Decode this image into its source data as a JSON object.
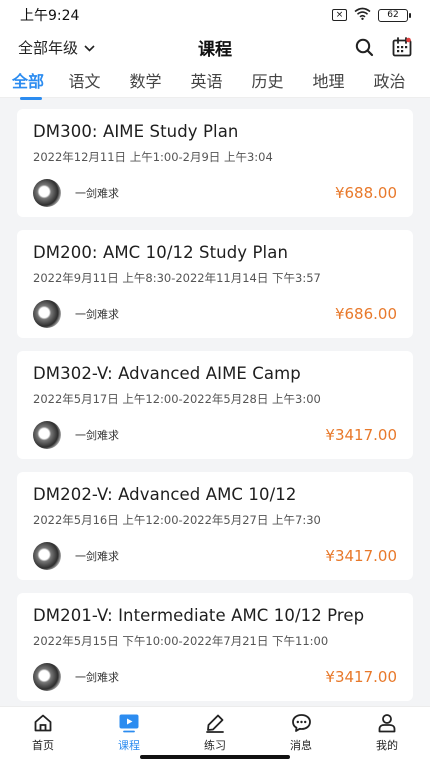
{
  "status_bar": {
    "time": "上午9:24",
    "x_label": "×",
    "battery": "62"
  },
  "header": {
    "grade_select": "全部年级",
    "title": "课程"
  },
  "tabs": [
    {
      "label": "全部"
    },
    {
      "label": "语文"
    },
    {
      "label": "数学"
    },
    {
      "label": "英语"
    },
    {
      "label": "历史"
    },
    {
      "label": "地理"
    },
    {
      "label": "政治"
    }
  ],
  "courses": [
    {
      "title": "DM300: AIME Study Plan",
      "time": "2022年12月11日 上午1:00-2月9日 上午3:04",
      "teacher": "一剑难求",
      "price": "¥688.00"
    },
    {
      "title": "DM200: AMC 10/12 Study Plan",
      "time": "2022年9月11日 上午8:30-2022年11月14日 下午3:57",
      "teacher": "一剑难求",
      "price": "¥686.00"
    },
    {
      "title": "DM302-V: Advanced AIME Camp",
      "time": "2022年5月17日 上午12:00-2022年5月28日 上午3:00",
      "teacher": "一剑难求",
      "price": "¥3417.00"
    },
    {
      "title": "DM202-V: Advanced AMC 10/12",
      "time": "2022年5月16日 上午12:00-2022年5月27日 上午7:30",
      "teacher": "一剑难求",
      "price": "¥3417.00"
    },
    {
      "title": "DM201-V: Intermediate AMC 10/12 Prep",
      "time": "2022年5月15日 下午10:00-2022年7月21日 下午11:00",
      "teacher": "一剑难求",
      "price": "¥3417.00"
    }
  ],
  "bottom_nav": [
    {
      "label": "首页",
      "icon": "home-icon"
    },
    {
      "label": "课程",
      "icon": "course-video-icon"
    },
    {
      "label": "练习",
      "icon": "pencil-icon"
    },
    {
      "label": "消息",
      "icon": "message-icon"
    },
    {
      "label": "我的",
      "icon": "profile-icon"
    }
  ],
  "colors": {
    "accent": "#2c8cf0",
    "price": "#e8792b"
  }
}
